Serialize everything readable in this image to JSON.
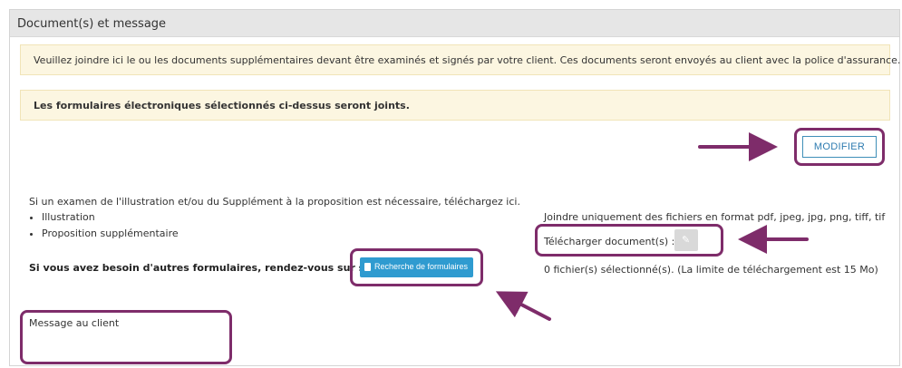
{
  "panel": {
    "title": "Document(s) et message"
  },
  "alerts": {
    "info": "Veuillez joindre ici le ou les documents supplémentaires devant être examinés et signés par votre client. Ces documents seront envoyés au client avec la police d'assurance.",
    "forms": "Les formulaires électroniques sélectionnés ci-dessus seront joints."
  },
  "buttons": {
    "modify": "MODIFIER",
    "search_forms": "Recherche de formulaires"
  },
  "exam": {
    "intro": "Si un examen de l'illustration et/ou du Supplément à la proposition est nécessaire, téléchargez ici.",
    "items": [
      "Illustration",
      "Proposition supplémentaire"
    ],
    "other_forms": "Si vous avez besoin d'autres formulaires, rendez-vous sur site ivari.ca"
  },
  "upload": {
    "formats": "Joindre uniquement des fichiers en format pdf, jpeg, jpg, png, tiff, tif",
    "label": "Télécharger document(s) :",
    "status": "0 fichier(s) sélectionné(s). (La limite de téléchargement est 15 Mo)"
  },
  "message": {
    "label": "Message au client"
  },
  "colors": {
    "highlight": "#7e2c6a",
    "alert_bg": "#fcf6e1",
    "button_blue": "#2f9bd0",
    "outline_blue": "#3f8fb8",
    "header_bg": "#e6e6e6"
  },
  "icons": {
    "upload": "paperclip-icon",
    "search": "document-icon"
  }
}
